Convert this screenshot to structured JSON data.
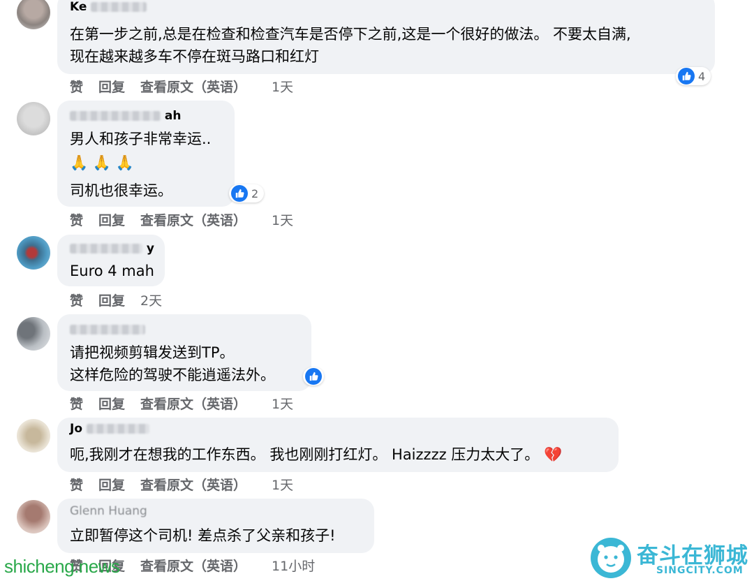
{
  "comments": [
    {
      "author": "Ke",
      "lines": [
        "在第一步之前,总是在检查和检查汽车是否停下之前,这是一个很好的做法。 不要太自满,",
        "现在越来越多车不停在斑马路口和红灯"
      ],
      "reactions": "4",
      "actions": {
        "like": "赞",
        "reply": "回复",
        "translate": "查看原文（英语）"
      },
      "time": "1天"
    },
    {
      "author": "ah",
      "lines": [
        "男人和孩子非常幸运..",
        "🙏 🙏 🙏",
        "司机也很幸运。"
      ],
      "reactions": "2",
      "actions": {
        "like": "赞",
        "reply": "回复",
        "translate": "查看原文（英语）"
      },
      "time": "1天"
    },
    {
      "author": "y",
      "lines": [
        "Euro 4 mah"
      ],
      "actions": {
        "like": "赞",
        "reply": "回复"
      },
      "time": "2天"
    },
    {
      "author": "",
      "lines": [
        "请把视频剪辑发送到TP。",
        "这样危险的驾驶不能逍遥法外。"
      ],
      "actions": {
        "like": "赞",
        "reply": "回复",
        "translate": "查看原文（英语）"
      },
      "time": "1天"
    },
    {
      "author": "Jo",
      "lines": [
        "呃,我刚才在想我的工作东西。 我也刚刚打红灯。 Haizzzz 压力太大了。 💔"
      ],
      "actions": {
        "like": "赞",
        "reply": "回复",
        "translate": "查看原文（英语）"
      },
      "time": "1天"
    },
    {
      "author": "Glenn Huang",
      "lines": [
        "立即暂停这个司机! 差点杀了父亲和孩子!"
      ],
      "actions": {
        "like": "赞",
        "reply": "回复",
        "translate": "查看原文（英语）"
      },
      "time": "11小时"
    }
  ],
  "watermark": "shicheng.news",
  "brand": {
    "title": "奋斗在狮城",
    "subtitle": "SINGCITY.COM"
  },
  "colors": {
    "bubble": "#f0f2f5",
    "like_blue": "#1877f2",
    "muted": "#65676b",
    "brand": "#3bb7d5",
    "watermark": "#2aa84a"
  }
}
